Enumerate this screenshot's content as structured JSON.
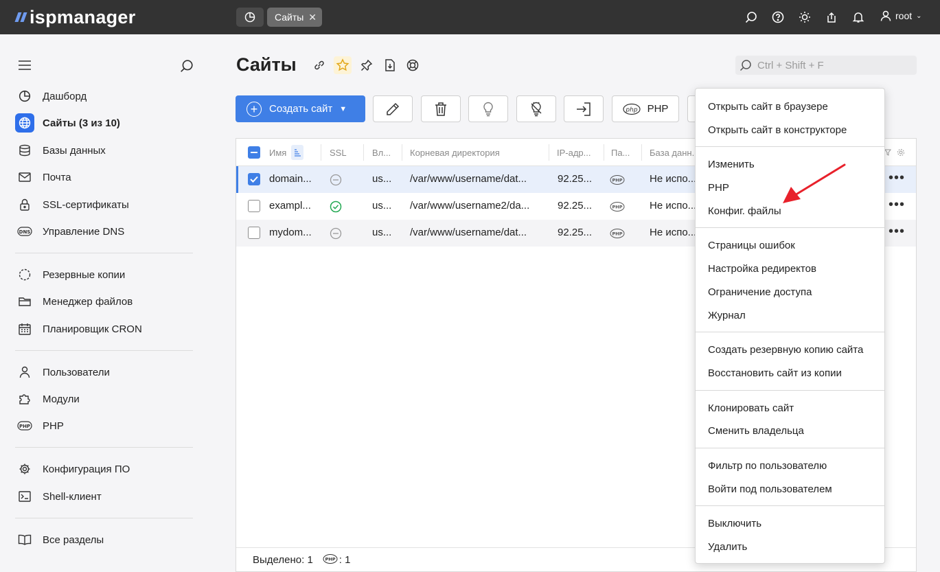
{
  "app": {
    "logo_text": "ispmanager"
  },
  "topbar": {
    "tab_label": "Сайты",
    "user": "root"
  },
  "sidebar": {
    "items": [
      {
        "label": "Дашборд",
        "icon": "dashboard-icon"
      },
      {
        "label": "Сайты (3 из 10)",
        "icon": "globe-icon",
        "active": true
      },
      {
        "label": "Базы данных",
        "icon": "database-icon"
      },
      {
        "label": "Почта",
        "icon": "mail-icon"
      },
      {
        "label": "SSL-сертификаты",
        "icon": "lock-icon"
      },
      {
        "label": "Управление DNS",
        "icon": "dns-icon"
      },
      {
        "label": "Резервные копии",
        "icon": "backup-icon"
      },
      {
        "label": "Менеджер файлов",
        "icon": "folder-icon"
      },
      {
        "label": "Планировщик CRON",
        "icon": "calendar-icon"
      },
      {
        "label": "Пользователи",
        "icon": "user-icon"
      },
      {
        "label": "Модули",
        "icon": "puzzle-icon"
      },
      {
        "label": "PHP",
        "icon": "php-icon"
      },
      {
        "label": "Конфигурация ПО",
        "icon": "gear-icon"
      },
      {
        "label": "Shell-клиент",
        "icon": "terminal-icon"
      },
      {
        "label": "Все разделы",
        "icon": "book-icon"
      }
    ]
  },
  "main": {
    "title": "Сайты",
    "search_placeholder": "Ctrl + Shift + F",
    "create_button": "Создать сайт",
    "php_button": "PHP"
  },
  "table": {
    "columns": [
      "Имя",
      "SSL",
      "Вл...",
      "Корневая директория",
      "IP-адр...",
      "Па...",
      "База данн..."
    ],
    "rows": [
      {
        "name": "domain...",
        "ssl": "none",
        "owner": "us...",
        "root": "/var/www/username/dat...",
        "ip": "92.25...",
        "db": "Не испо...",
        "checked": true
      },
      {
        "name": "exampl...",
        "ssl": "ok",
        "owner": "us...",
        "root": "/var/www/username2/da...",
        "ip": "92.25...",
        "db": "Не испо...",
        "checked": false
      },
      {
        "name": "mydom...",
        "ssl": "none",
        "owner": "us...",
        "root": "/var/www/username/dat...",
        "ip": "92.25...",
        "db": "Не испо...",
        "checked": false
      }
    ],
    "footer_selected": "Выделено: 1",
    "footer_php": ": 1"
  },
  "context_menu": {
    "groups": [
      [
        "Открыть сайт в браузере",
        "Открыть сайт в конструкторе"
      ],
      [
        "Изменить",
        "PHP",
        "Конфиг. файлы"
      ],
      [
        "Страницы ошибок",
        "Настройка редиректов",
        "Ограничение доступа",
        "Журнал"
      ],
      [
        "Создать резервную копию сайта",
        "Восстановить сайт из копии"
      ],
      [
        "Клонировать сайт",
        "Сменить владельца"
      ],
      [
        "Фильтр по пользователю",
        "Войти под пользователем"
      ],
      [
        "Выключить",
        "Удалить"
      ]
    ]
  },
  "colors": {
    "accent": "#3f7fe6",
    "topbar": "#333333",
    "arrow": "#e8212b"
  }
}
